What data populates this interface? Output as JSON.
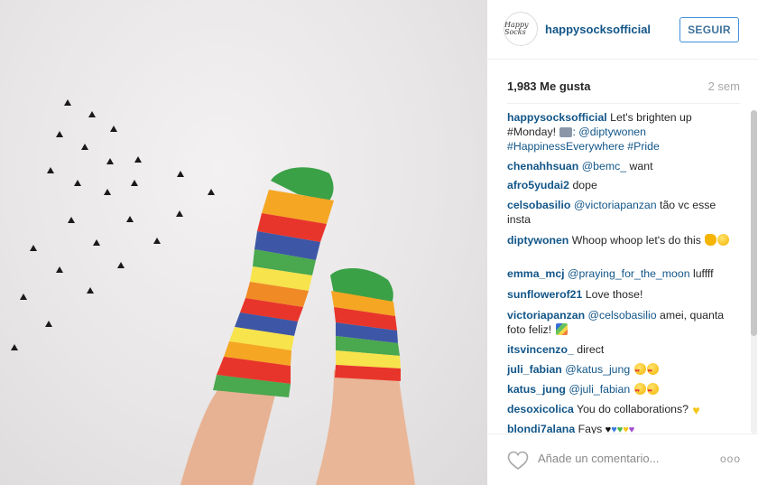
{
  "post": {
    "username": "happysocksofficial",
    "avatar_text": "Happy Socks",
    "follow_label": "SEGUIR",
    "likes": "1,983 Me gusta",
    "time": "2 sem"
  },
  "comments": [
    {
      "user": "happysocksofficial",
      "text": "Let's brighten up #Monday!",
      "text2": ": @diptywonen",
      "text3": "#HappinessEverywhere #Pride"
    },
    {
      "user": "chenahhsuan",
      "mention": "@bemc_",
      "text": " want"
    },
    {
      "user": "afro5yudai2",
      "text": " dope"
    },
    {
      "user": "celsobasilio",
      "mention": "@victoriapanzan",
      "text": " tão vc esse insta"
    },
    {
      "user": "diptywonen",
      "text": " Whoop whoop let's do this"
    },
    {
      "user": "emma_mcj",
      "mention": "@praying_for_the_moon",
      "text": " luffff"
    },
    {
      "user": "sunflowerof21",
      "text": " Love those!"
    },
    {
      "user": "victoriapanzan",
      "mention": "@celsobasilio",
      "text": " amei, quanta foto feliz!"
    },
    {
      "user": "itsvincenzo_",
      "text": " direct"
    },
    {
      "user": "juli_fabian",
      "mention": "@katus_jung",
      "text": " "
    },
    {
      "user": "katus_jung",
      "mention": "@juli_fabian",
      "text": " "
    },
    {
      "user": "desoxicolica",
      "text": " You do collaborations?"
    },
    {
      "user": "blondi7alana",
      "text": " Fays"
    }
  ],
  "footer": {
    "placeholder": "Añade un comentario...",
    "more": "ooo"
  },
  "icons": {
    "like": "heart-outline-icon",
    "more": "more-options-icon"
  },
  "colors": {
    "link": "#125688",
    "follow_border": "#4090db",
    "follow_text": "#3f729b",
    "muted": "#a5a7aa"
  }
}
